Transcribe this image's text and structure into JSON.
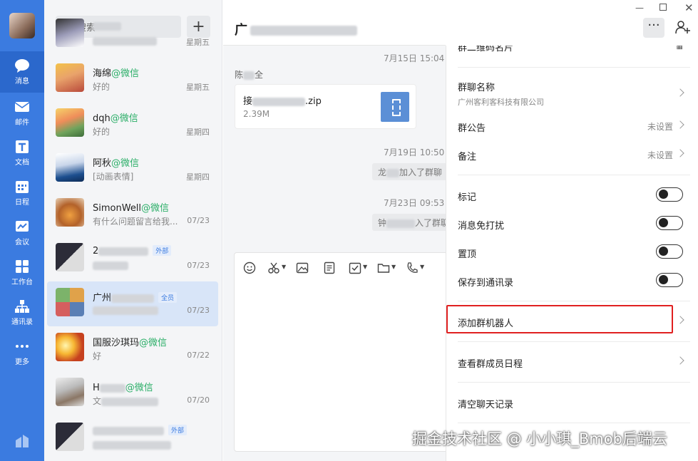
{
  "nav": {
    "items": [
      {
        "label": "消息",
        "icon": "message-icon"
      },
      {
        "label": "邮件",
        "icon": "mail-icon"
      },
      {
        "label": "文档",
        "icon": "doc-icon"
      },
      {
        "label": "日程",
        "icon": "calendar-icon"
      },
      {
        "label": "会议",
        "icon": "meeting-icon"
      },
      {
        "label": "工作台",
        "icon": "workbench-icon"
      },
      {
        "label": "通讯录",
        "icon": "contacts-icon"
      },
      {
        "label": "更多",
        "icon": "more-icon"
      }
    ]
  },
  "search": {
    "placeholder": "搜索"
  },
  "conversations": [
    {
      "name": "",
      "suffix": "",
      "preview": "",
      "time": "星期五",
      "tag": ""
    },
    {
      "name": "海绵",
      "suffix": "@微信",
      "preview": "好的",
      "time": "星期五",
      "tag": ""
    },
    {
      "name": "dqh",
      "suffix": "@微信",
      "preview": "好的",
      "time": "星期四",
      "tag": ""
    },
    {
      "name": "阿秋",
      "suffix": "@微信",
      "preview": "[动画表情]",
      "time": "星期四",
      "tag": ""
    },
    {
      "name": "SimonWell",
      "suffix": "@微信",
      "preview": "有什么问题留言给我...",
      "time": "07/23",
      "tag": ""
    },
    {
      "name": "2",
      "suffix": "",
      "preview": "",
      "time": "07/23",
      "tag": "外部"
    },
    {
      "name": "广州",
      "suffix": "",
      "preview": "",
      "time": "07/23",
      "tag": "全员"
    },
    {
      "name": "国服沙琪玛",
      "suffix": "@微信",
      "preview": "好",
      "time": "07/22",
      "tag": ""
    },
    {
      "name": "H",
      "suffix": "@微信",
      "preview": "文",
      "time": "07/20",
      "tag": ""
    },
    {
      "name": "",
      "suffix": "",
      "preview": "",
      "time": "",
      "tag": "外部"
    }
  ],
  "chat": {
    "title": "广",
    "stamp1": "7月15日 15:04",
    "sender": "陈",
    "sender_tail": "全",
    "file_name": "接",
    "file_name_tail": ".zip",
    "file_size": "2.39M",
    "stamp2": "7月19日 10:50",
    "sys1_head": "龙",
    "sys1_tail": "加入了群聊",
    "stamp3": "7月23日 09:53",
    "sys2_head": "钟",
    "sys2_tail": "入了群聊"
  },
  "panel": {
    "qr_partial": "群二维码名片",
    "group_name_label": "群聊名称",
    "group_name_value": "广州客利客科技有限公司",
    "announcement_label": "群公告",
    "announcement_value": "未设置",
    "remark_label": "备注",
    "remark_value": "未设置",
    "mark_label": "标记",
    "mute_label": "消息免打扰",
    "pin_label": "置顶",
    "save_label": "保存到通讯录",
    "add_bot_label": "添加群机器人",
    "schedule_label": "查看群成员日程",
    "clear_label": "清空聊天记录"
  },
  "watermark": "掘金技术社区 @ 小小琪_Bmob后端云",
  "colors": {
    "accent": "#3b7be0",
    "wechat_green": "#2aae67",
    "highlight_red": "#e02020"
  }
}
